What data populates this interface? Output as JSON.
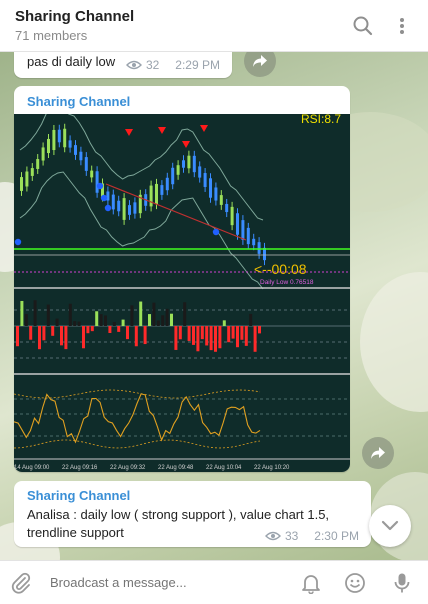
{
  "header": {
    "title": "Sharing Channel",
    "subtitle": "71 members"
  },
  "messages": [
    {
      "text": "pas di daily low",
      "views": "32",
      "time": "2:29 PM"
    },
    {
      "sender": "Sharing Channel",
      "chart": {
        "indicator_label": "RSI:8.7",
        "countdown": "<--00:08",
        "daily_low_label": "Daily Low  0.76518",
        "x_tick_labels": [
          "14 Aug 09:00",
          "22 Aug 09:16",
          "22 Aug 09:32",
          "22 Aug 09:48",
          "22 Aug 10:04",
          "22 Aug 10:20"
        ]
      }
    },
    {
      "sender": "Sharing Channel",
      "text": "Analisa : daily low ( strong support ), value chart 1.5, trendline support",
      "views": "33",
      "time": "2:30 PM"
    }
  ],
  "composer": {
    "placeholder": "Broadcast a message..."
  },
  "colors": {
    "accent": "#3a8fd6",
    "chart_bg": "#0f2c2a",
    "candle_up": "#9be05a",
    "candle_down": "#3a8cff",
    "bar_down": "#ff2a2a",
    "wave": "#e0a020",
    "arrow_red": "#ff1a1a"
  }
}
